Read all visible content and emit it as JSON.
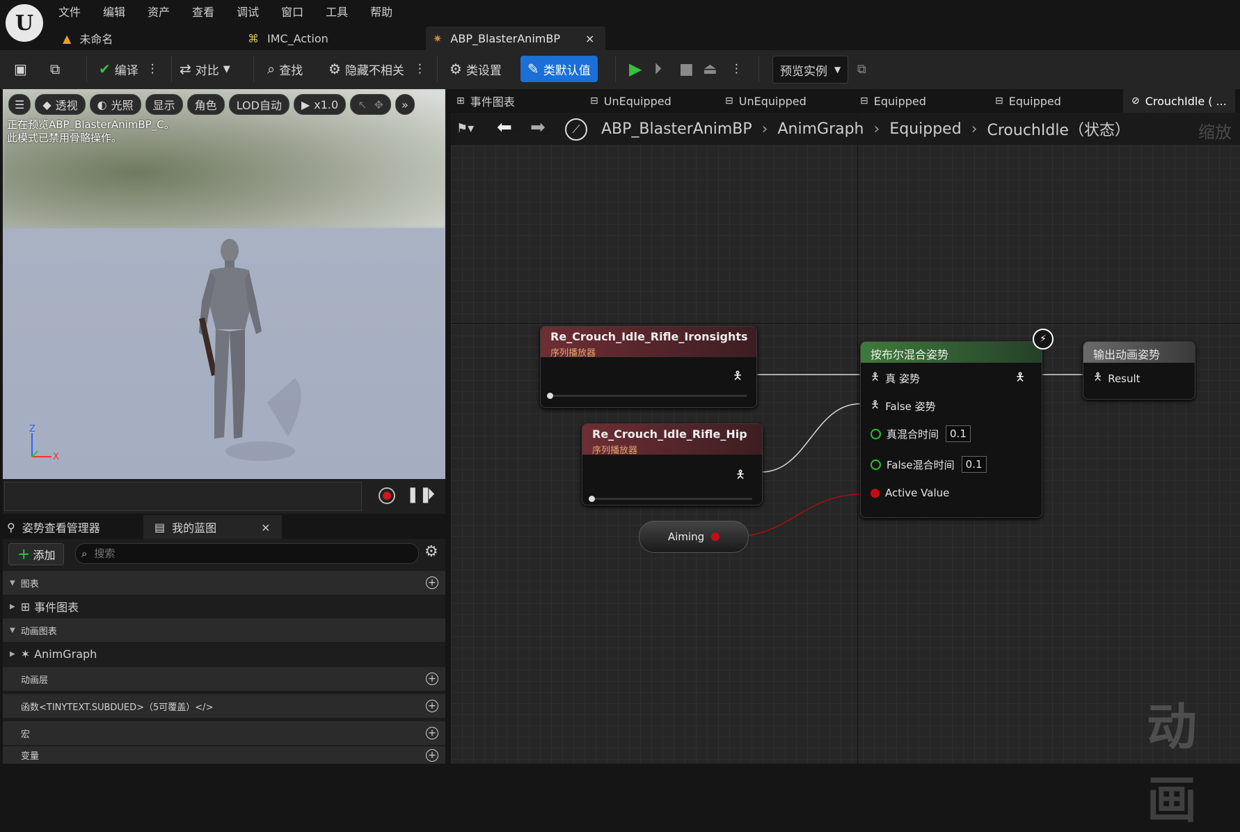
{
  "menu": [
    "文件",
    "编辑",
    "资产",
    "查看",
    "调试",
    "窗口",
    "工具",
    "帮助"
  ],
  "doc_tabs": [
    {
      "label": "未命名",
      "icon": "level-icon"
    },
    {
      "label": "IMC_Action",
      "icon": "input-mapping-icon"
    },
    {
      "label": "ABP_BlasterAnimBP",
      "icon": "anim-blueprint-icon",
      "close": "×"
    }
  ],
  "toolbar": {
    "compile": "编译",
    "diff": "对比",
    "find": "查找",
    "hide_unrelated": "隐藏不相关",
    "class_settings": "类设置",
    "class_defaults": "类默认值",
    "preview_instance": "预览实例"
  },
  "viewport": {
    "buttons": [
      "透视",
      "光照",
      "显示",
      "角色",
      "LOD自动",
      "x1.0"
    ],
    "info_line1": "正在预览ABP_BlasterAnimBP_C。",
    "info_line2": "此模式已禁用骨骼操作。",
    "axis_z": "Z",
    "axis_x": "X"
  },
  "left_panel": {
    "tab1": "姿势查看管理器",
    "tab2": "我的蓝图",
    "tab2_close": "×",
    "add": "添加",
    "search_placeholder": "搜索",
    "sections": [
      {
        "label": "图表",
        "type": "header",
        "plus": true
      },
      {
        "label": "事件图表",
        "type": "item"
      },
      {
        "label": "动画图表",
        "type": "header"
      },
      {
        "label": "AnimGraph",
        "type": "item"
      },
      {
        "label": "动画层",
        "type": "header",
        "plus": true
      },
      {
        "label": "函数<TINYTEXT.SUBDUED>（5可覆盖）</>",
        "type": "header",
        "plus": true
      },
      {
        "label": "宏",
        "type": "header",
        "plus": true
      },
      {
        "label": "变量",
        "type": "header",
        "plus": true
      }
    ]
  },
  "graph_tabs": [
    "事件图表",
    "UnEquipped",
    "UnEquipped",
    "Equipped",
    "Equipped",
    "CrouchIdle ( ..."
  ],
  "breadcrumb": [
    "ABP_BlasterAnimBP",
    "AnimGraph",
    "Equipped",
    "CrouchIdle（状态）"
  ],
  "zoom_text": "缩放",
  "watermark": "动画",
  "nodes": {
    "seq1": {
      "title": "Re_Crouch_Idle_Rifle_Ironsights",
      "subtitle": "序列播放器"
    },
    "seq2": {
      "title": "Re_Crouch_Idle_Rifle_Hip",
      "subtitle": "序列播放器"
    },
    "blend": {
      "title": "按布尔混合姿势",
      "true_pose": "真 姿势",
      "false_pose": "False 姿势",
      "true_blend": "真混合时间",
      "true_blend_value": "0.1",
      "false_blend": "False混合时间",
      "false_blend_value": "0.1",
      "active_value": "Active Value"
    },
    "output": {
      "title": "输出动画姿势",
      "result": "Result"
    },
    "aiming": "Aiming"
  }
}
